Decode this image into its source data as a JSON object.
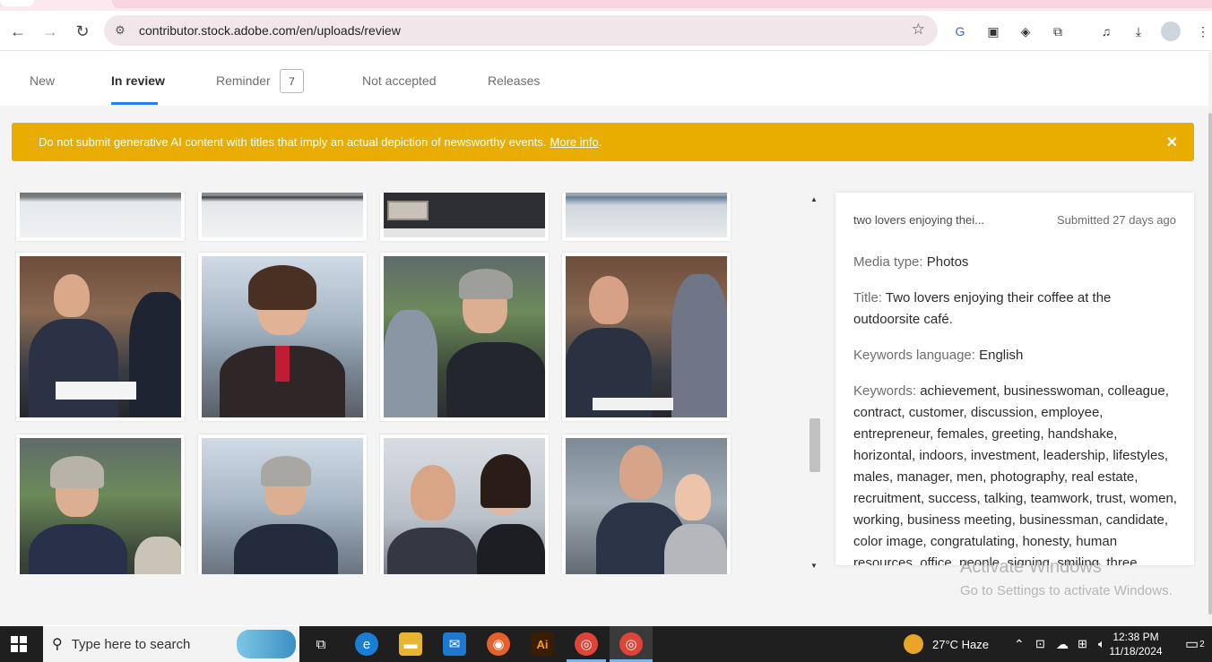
{
  "browser": {
    "url": "contributor.stock.adobe.com/en/uploads/review"
  },
  "tabs": {
    "new": "New",
    "in_review": "In review",
    "reminder": "Reminder",
    "reminder_count": "7",
    "not_accepted": "Not accepted",
    "releases": "Releases"
  },
  "banner": {
    "text": "Do not submit generative AI content with titles that imply an actual depiction of newsworthy events.",
    "link": "More info",
    "period": ".",
    "close": "✕"
  },
  "detail": {
    "short_title": "two lovers enjoying thei...",
    "submitted": "Submitted 27 days ago",
    "media_type_label": "Media type:",
    "media_type": "Photos",
    "title_label": "Title:",
    "title": "Two lovers enjoying their coffee at the outdoorsite café.",
    "keywords_language_label": "Keywords language:",
    "keywords_language": "English",
    "keywords_label": "Keywords:",
    "keywords": "achievement, businesswoman, colleague, contract, customer, discussion, employee, entrepreneur, females, greeting, handshake, horizontal, indoors, investment, leadership, lifestyles, males, manager, men, photography, real estate, recruitment, success, talking, teamwork, trust, women, working, business meeting, businessman, candidate, color image, congratulating, honesty, human resources, office, people, signing, smiling, three people, business, business person"
  },
  "watermark": {
    "line1": "Activate Windows",
    "line2": "Go to Settings to activate Windows."
  },
  "taskbar": {
    "search_placeholder": "Type here to search",
    "weather": "27°C  Haze",
    "time": "12:38 PM",
    "date": "11/18/2024",
    "notifications": "2"
  }
}
